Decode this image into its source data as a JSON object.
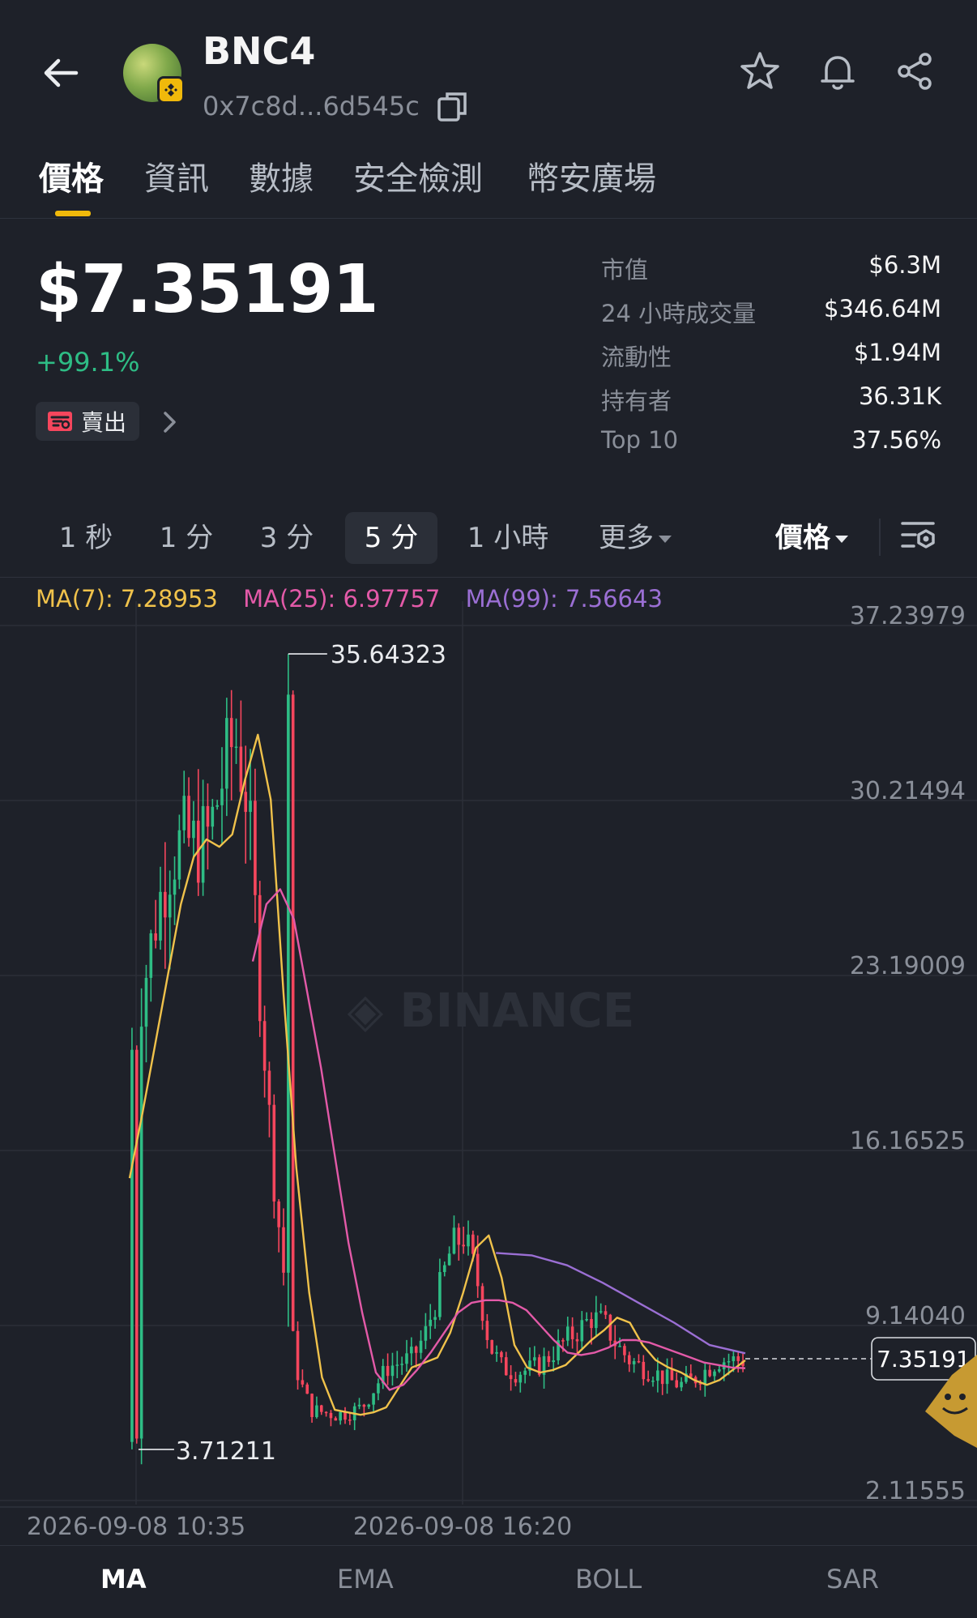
{
  "header": {
    "token_name": "BNC4",
    "address": "0x7c8d...6d545c"
  },
  "tabs": [
    "價格",
    "資訊",
    "數據",
    "安全檢測",
    "幣安廣場"
  ],
  "active_tab": 0,
  "price": {
    "value": "$7.35191",
    "change": "+99.1%",
    "sell_label": "賣出"
  },
  "stats": [
    {
      "label": "市值",
      "value": "$6.3M"
    },
    {
      "label": "24 小時成交量",
      "value": "$346.64M"
    },
    {
      "label": "流動性",
      "value": "$1.94M"
    },
    {
      "label": "持有者",
      "value": "36.31K"
    },
    {
      "label": "Top 10",
      "value": "37.56%"
    }
  ],
  "timeframes": [
    "1 秒",
    "1 分",
    "3 分",
    "5 分",
    "1 小時",
    "更多"
  ],
  "active_timeframe": 3,
  "price_mode": "價格",
  "ma_legend": {
    "ma7": "MA(7): 7.28953",
    "ma25": "MA(25): 6.97757",
    "ma99": "MA(99): 7.56643"
  },
  "watermark": "BINANCE",
  "chart_data": {
    "type": "line",
    "x_ticks": [
      "2026-09-08 10:35",
      "2026-09-08 16:20"
    ],
    "y_ticks": [
      "37.23979",
      "30.21494",
      "23.19009",
      "16.16525",
      "9.14040",
      "2.11555"
    ],
    "ylim": [
      2.11555,
      37.23979
    ],
    "high_label": "35.64323",
    "low_label": "3.71211",
    "current_price_label": "7.35191",
    "high": 35.64323,
    "low": 3.71211,
    "current": 7.35191,
    "colors": {
      "ma7": "#f0c24b",
      "ma25": "#e35aa8",
      "ma99": "#9b6fd4",
      "up": "#2ebd85",
      "down": "#f6465d"
    },
    "series": [
      {
        "name": "MA(7)",
        "values": [
          14.6,
          17.2,
          20.0,
          22.8,
          25.6,
          27.5,
          28.2,
          27.9,
          28.4,
          30.6,
          32.4,
          29.8,
          22.0,
          15.0,
          10.0,
          6.6,
          5.3,
          5.2,
          5.1,
          5.2,
          5.4,
          6.2,
          7.0,
          7.2,
          7.4,
          8.4,
          10.0,
          11.8,
          12.3,
          10.6,
          7.9,
          7.0,
          6.8,
          6.9,
          7.1,
          7.6,
          8.1,
          8.5,
          9.0,
          8.8,
          7.9,
          7.3,
          7.0,
          6.8,
          6.5,
          6.3,
          6.5,
          6.9,
          7.29
        ]
      },
      {
        "name": "MA(25)",
        "values": [
          null,
          null,
          null,
          null,
          null,
          null,
          null,
          null,
          null,
          23.3,
          25.6,
          26.2,
          25.0,
          22.0,
          19.0,
          15.5,
          12.0,
          9.2,
          6.8,
          6.1,
          6.3,
          6.9,
          7.6,
          8.4,
          9.2,
          9.6,
          9.7,
          9.7,
          9.6,
          9.3,
          8.7,
          8.1,
          7.6,
          7.5,
          7.6,
          7.8,
          8.1,
          8.1,
          8.0,
          7.8,
          7.6,
          7.4,
          7.2,
          7.1,
          7.0,
          6.97
        ]
      },
      {
        "name": "MA(99)",
        "values": [
          11.6,
          11.5,
          11.1,
          10.4,
          9.6,
          8.8,
          7.9,
          7.57
        ]
      }
    ]
  },
  "indicators": [
    "MA",
    "EMA",
    "BOLL",
    "SAR"
  ],
  "active_indicator": 0
}
